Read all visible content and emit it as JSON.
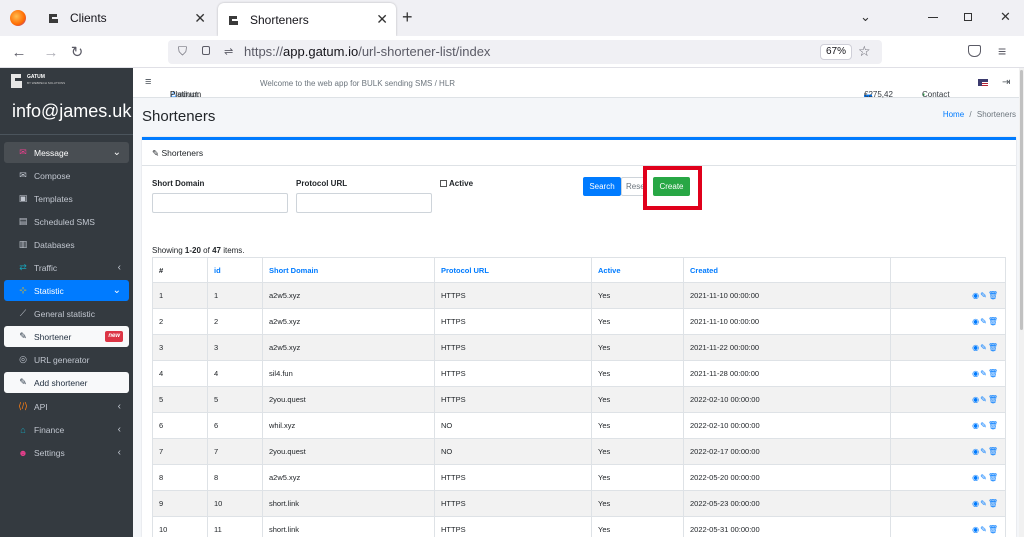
{
  "browser": {
    "tabs": [
      {
        "title": "Clients",
        "active": false
      },
      {
        "title": "Shorteners",
        "active": true
      }
    ],
    "url_scheme": "https://",
    "url_host": "app.gatum.io",
    "url_path": "/url-shortener-list/index",
    "zoom": "67%"
  },
  "sidebar": {
    "brand_line1": "GATUM",
    "brand_line2": "BY WEBPECH SOLUTIONS",
    "user": "info@james.uk",
    "items": [
      {
        "label": "Message",
        "icon": "message-icon"
      },
      {
        "label": "Compose",
        "icon": "envelope-icon"
      },
      {
        "label": "Templates",
        "icon": "template-icon"
      },
      {
        "label": "Scheduled SMS",
        "icon": "clock-icon"
      },
      {
        "label": "Databases",
        "icon": "database-icon"
      },
      {
        "label": "Traffic",
        "icon": "traffic-icon"
      },
      {
        "label": "Statistic",
        "icon": "chart-icon"
      },
      {
        "label": "General statistic",
        "icon": "line-chart-icon"
      },
      {
        "label": "Shortener",
        "icon": "pen-icon",
        "badge": "new"
      },
      {
        "label": "URL generator",
        "icon": "target-icon"
      },
      {
        "label": "Add shortener",
        "icon": "pen-icon"
      },
      {
        "label": "API",
        "icon": "code-icon"
      },
      {
        "label": "Finance",
        "icon": "bank-icon"
      },
      {
        "label": "Settings",
        "icon": "users-icon"
      }
    ]
  },
  "topbar": {
    "product_label": "Product:",
    "product_value": "Platinum",
    "welcome": "Welcome to the web app for BULK sending SMS / HLR",
    "balance": "€275,42",
    "contact": "Contact"
  },
  "page": {
    "title": "Shorteners",
    "breadcrumb_home": "Home",
    "breadcrumb_sep": "/",
    "breadcrumb_current": "Shorteners"
  },
  "card": {
    "header": "Shorteners",
    "filters": {
      "short_domain_label": "Short Domain",
      "protocol_url_label": "Protocol URL",
      "active_label": "Active",
      "short_domain_value": "",
      "protocol_url_value": ""
    },
    "buttons": {
      "search": "Search",
      "reset": "Reset",
      "create": "Create"
    },
    "summary_prefix": "Showing ",
    "summary_range": "1-20",
    "summary_mid": " of ",
    "summary_total": "47",
    "summary_suffix": " items."
  },
  "table": {
    "columns": [
      "#",
      "id",
      "Short Domain",
      "Protocol URL",
      "Active",
      "Created",
      ""
    ],
    "rows": [
      [
        "1",
        "1",
        "a2w5.xyz",
        "HTTPS",
        "Yes",
        "2021-11-10 00:00:00"
      ],
      [
        "2",
        "2",
        "a2w5.xyz",
        "HTTPS",
        "Yes",
        "2021-11-10 00:00:00"
      ],
      [
        "3",
        "3",
        "a2w5.xyz",
        "HTTPS",
        "Yes",
        "2021-11-22 00:00:00"
      ],
      [
        "4",
        "4",
        "sil4.fun",
        "HTTPS",
        "Yes",
        "2021-11-28 00:00:00"
      ],
      [
        "5",
        "5",
        "2you.quest",
        "HTTPS",
        "Yes",
        "2022-02-10 00:00:00"
      ],
      [
        "6",
        "6",
        "whil.xyz",
        "NO",
        "Yes",
        "2022-02-10 00:00:00"
      ],
      [
        "7",
        "7",
        "2you.quest",
        "NO",
        "Yes",
        "2022-02-17 00:00:00"
      ],
      [
        "8",
        "8",
        "a2w5.xyz",
        "HTTPS",
        "Yes",
        "2022-05-20 00:00:00"
      ],
      [
        "9",
        "10",
        "short.link",
        "HTTPS",
        "Yes",
        "2022-05-23 00:00:00"
      ],
      [
        "10",
        "11",
        "short.link",
        "HTTPS",
        "Yes",
        "2022-05-31 00:00:00"
      ]
    ],
    "action_icons": [
      "eye-icon",
      "edit-icon",
      "trash-icon"
    ]
  },
  "colors": {
    "primary": "#007bff",
    "success": "#28a745",
    "sidebar_bg": "#343a40",
    "highlight": "#e0001b"
  }
}
